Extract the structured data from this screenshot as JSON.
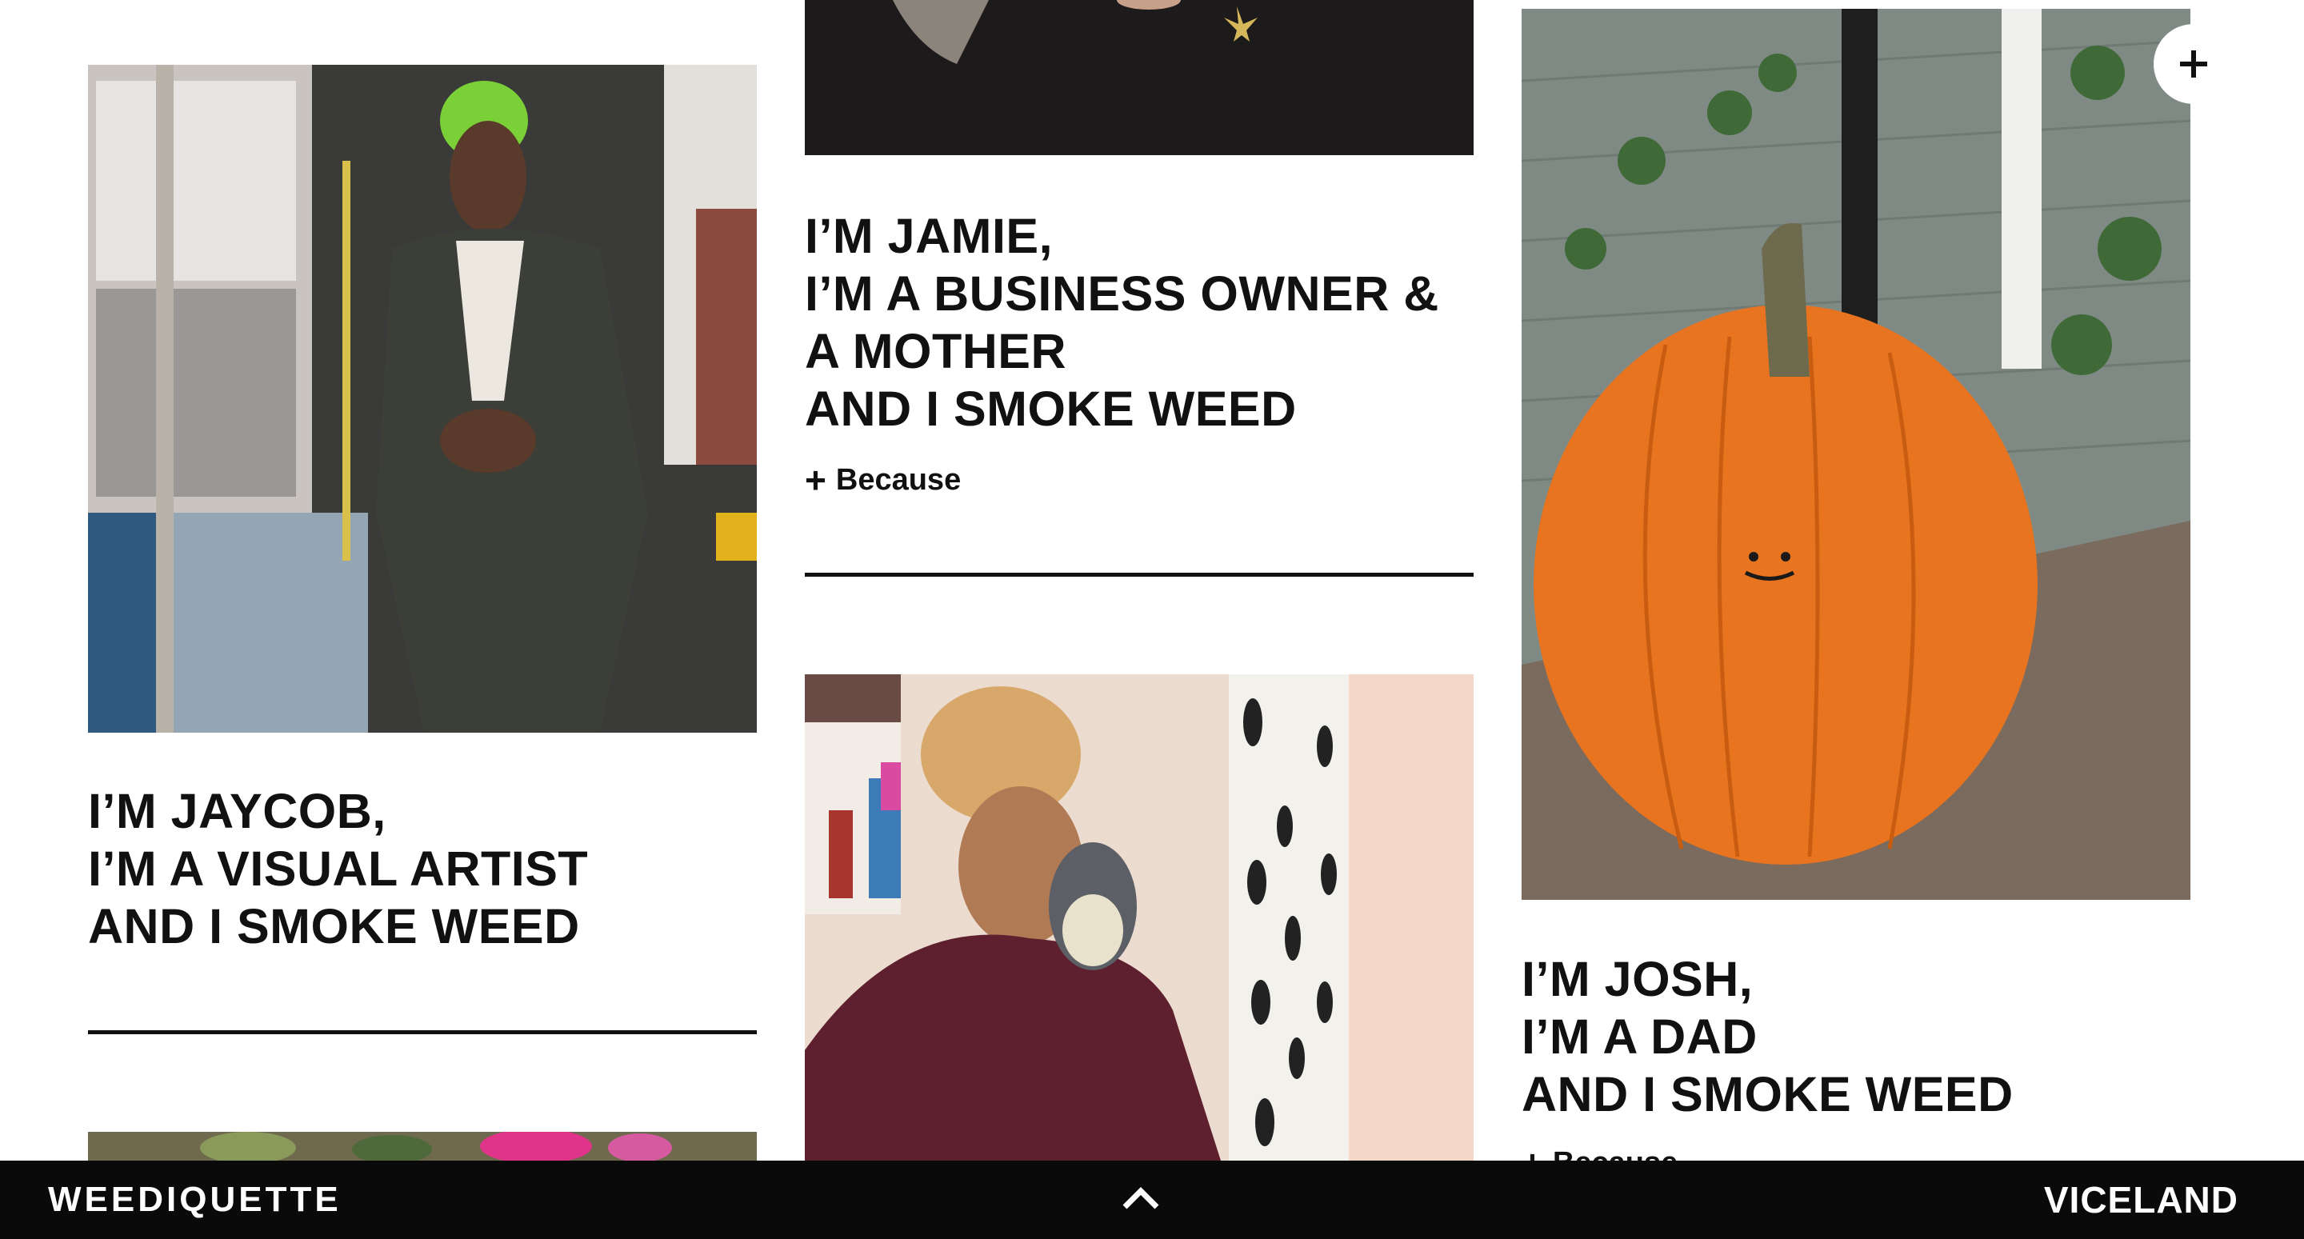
{
  "cards": [
    {
      "id": "jaycob",
      "title_lines": [
        "I’M JAYCOB,",
        "I’M A VISUAL ARTIST",
        "AND I SMOKE WEED"
      ],
      "image_alt": "Man with green hair in a suit standing on a bus"
    },
    {
      "id": "jamie",
      "title_lines": [
        "I’M JAMIE,",
        "I’M A BUSINESS OWNER &",
        "A MOTHER",
        "AND I SMOKE WEED"
      ],
      "because_label": "Because",
      "image_alt": "Person in black shirt with leaf pendant"
    },
    {
      "id": "josh",
      "title_lines": [
        "I’M JOSH,",
        "I’M A DAD",
        "AND I SMOKE WEED"
      ],
      "because_label": "Because",
      "image_alt": "Orange pumpkin with drawn smiley face"
    },
    {
      "id": "selfie",
      "image_alt": "Woman taking mirror selfie with totoro phone case"
    },
    {
      "id": "flowers",
      "image_alt": "Pink flowers"
    }
  ],
  "footer": {
    "brand_left": "WEEDIQUETTE",
    "brand_right": "VICELAND",
    "up_icon": "chevron-up-icon"
  },
  "floating": {
    "plus_icon": "plus-icon"
  },
  "colors": {
    "footer_bg": "#0a0a0a",
    "text": "#111111",
    "pumpkin": "#e8741f"
  }
}
